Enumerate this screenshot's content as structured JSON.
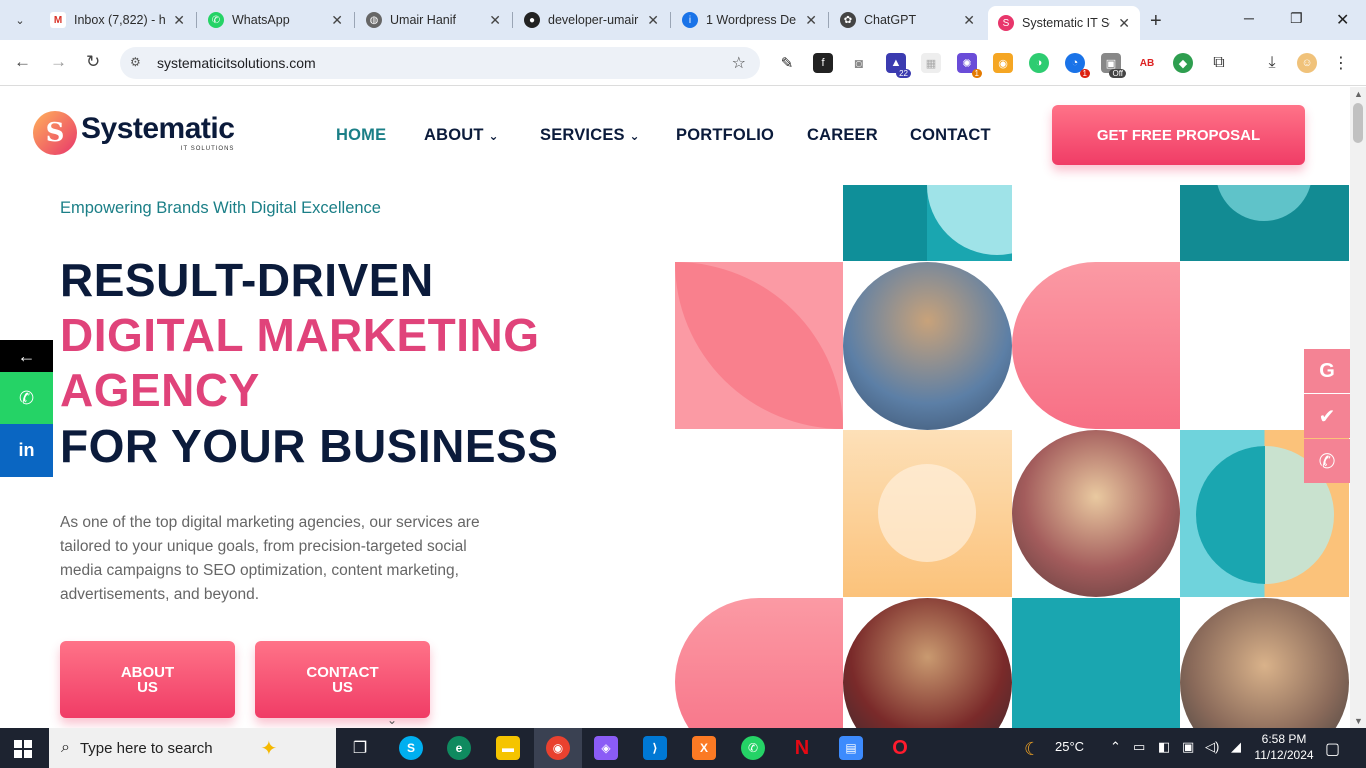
{
  "browser": {
    "tabs": [
      {
        "label": "Inbox (7,822) - h",
        "icon": "gmail-icon",
        "color": "#d93025"
      },
      {
        "label": "WhatsApp",
        "icon": "whatsapp-icon",
        "color": "#25d366"
      },
      {
        "label": "Umair Hanif",
        "icon": "globe-icon",
        "color": "#555555"
      },
      {
        "label": "developer-umair",
        "icon": "github-icon",
        "color": "#222222"
      },
      {
        "label": "1 Wordpress De",
        "icon": "info-icon",
        "color": "#1a73e8"
      },
      {
        "label": "ChatGPT",
        "icon": "chatgpt-icon",
        "color": "#333333"
      },
      {
        "label": "Systematic IT So",
        "icon": "systematic-icon",
        "color": "#e8366b"
      }
    ],
    "url": "systematicitsolutions.com",
    "extension_badges": {
      "ext_22": "22",
      "ext_1": "1",
      "ext_off": "Off",
      "ext_red": "1"
    }
  },
  "site": {
    "logo_text": "Systematic",
    "logo_sub": "IT SOLUTIONS",
    "nav": {
      "home": "HOME",
      "about": "ABOUT",
      "services": "SERVICES",
      "portfolio": "PORTFOLIO",
      "career": "CAREER",
      "contact": "CONTACT"
    },
    "cta": "GET FREE PROPOSAL",
    "tagline": "Empowering Brands With Digital Excellence",
    "hero": {
      "line1": "RESULT-DRIVEN",
      "line2": "DIGITAL MARKETING",
      "line3": "AGENCY",
      "line4": "FOR YOUR BUSINESS"
    },
    "description": "As one of the top digital marketing agencies, our services are tailored to your unique goals, from precision-targeted social media campaigns to SEO optimization, content marketing, advertisements, and beyond.",
    "buttons": {
      "about": "ABOUT US",
      "contact": "CONTACT US"
    },
    "colors": {
      "teal": "#1b7f87",
      "pink": "#e0437a",
      "navy": "#0b1b3b",
      "button": "#f03c66"
    }
  },
  "taskbar": {
    "search_placeholder": "Type here to search",
    "weather": "25°C",
    "time": "6:58 PM",
    "date": "11/12/2024"
  }
}
